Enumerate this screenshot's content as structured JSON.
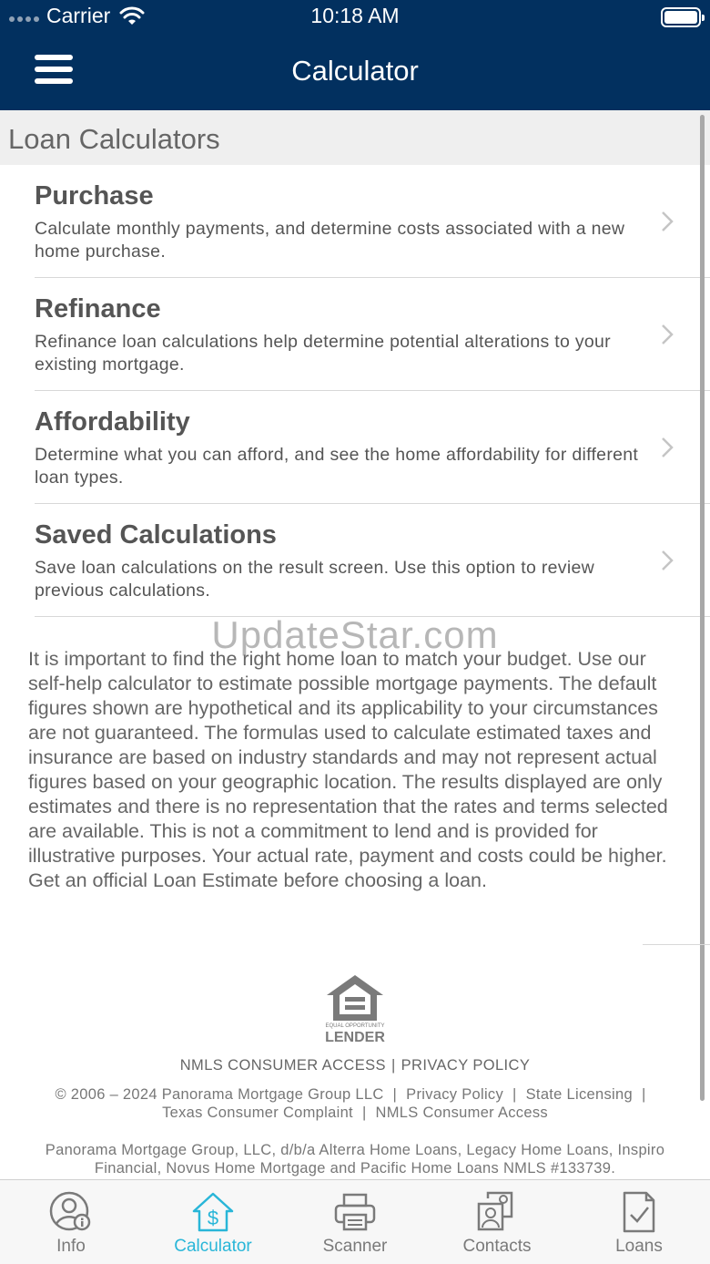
{
  "status_bar": {
    "carrier": "Carrier",
    "time": "10:18 AM"
  },
  "nav": {
    "title": "Calculator"
  },
  "section": {
    "header": "Loan Calculators"
  },
  "calculators": [
    {
      "title": "Purchase",
      "description": "Calculate monthly payments, and determine costs associated with a new home purchase."
    },
    {
      "title": "Refinance",
      "description": "Refinance loan calculations help determine potential alterations to your existing mortgage."
    },
    {
      "title": "Affordability",
      "description": "Determine what you can afford, and see the home affordability for different loan types."
    },
    {
      "title": "Saved Calculations",
      "description": "Save loan calculations on the result screen. Use this option to review previous calculations."
    }
  ],
  "watermark": "UpdateStar.com",
  "disclaimer": "It is important to find the right home loan to match your budget. Use our self-help calculator to estimate possible mortgage payments. The default figures shown are hypothetical and its applicability to your circumstances are not guaranteed. The formulas used to calculate estimated taxes and insurance are based on industry standards and may not represent actual figures based on your geographic location.  The results displayed are only estimates and there is no representation that the rates and terms selected are available.  This is not a commitment to lend and is provided for illustrative purposes.  Your actual rate, payment and costs could be higher. Get an official Loan Estimate before choosing a loan.",
  "logo": {
    "line1": "EQUAL OPPORTUNITY",
    "line2": "LENDER"
  },
  "footer": {
    "nmls_access": "NMLS CONSUMER ACCESS",
    "separator": "|",
    "privacy_policy": "PRIVACY POLICY",
    "copyright": "© 2006 – 2024 Panorama Mortgage Group LLC",
    "links": [
      "Privacy Policy",
      "State Licensing",
      "Texas Consumer Complaint",
      "NMLS Consumer Access"
    ],
    "legal": "Panorama Mortgage Group, LLC, d/b/a Alterra Home Loans, Legacy Home Loans, Inspiro Financial, Novus Home Mortgage and Pacific Home Loans NMLS #133739."
  },
  "tabs": [
    {
      "label": "Info",
      "icon": "user-info-icon"
    },
    {
      "label": "Calculator",
      "icon": "house-dollar-icon",
      "active": true
    },
    {
      "label": "Scanner",
      "icon": "printer-icon"
    },
    {
      "label": "Contacts",
      "icon": "contacts-icon"
    },
    {
      "label": "Loans",
      "icon": "document-check-icon"
    }
  ],
  "colors": {
    "nav_bg": "#02305f",
    "accent": "#29b6d8",
    "text": "#555555"
  }
}
